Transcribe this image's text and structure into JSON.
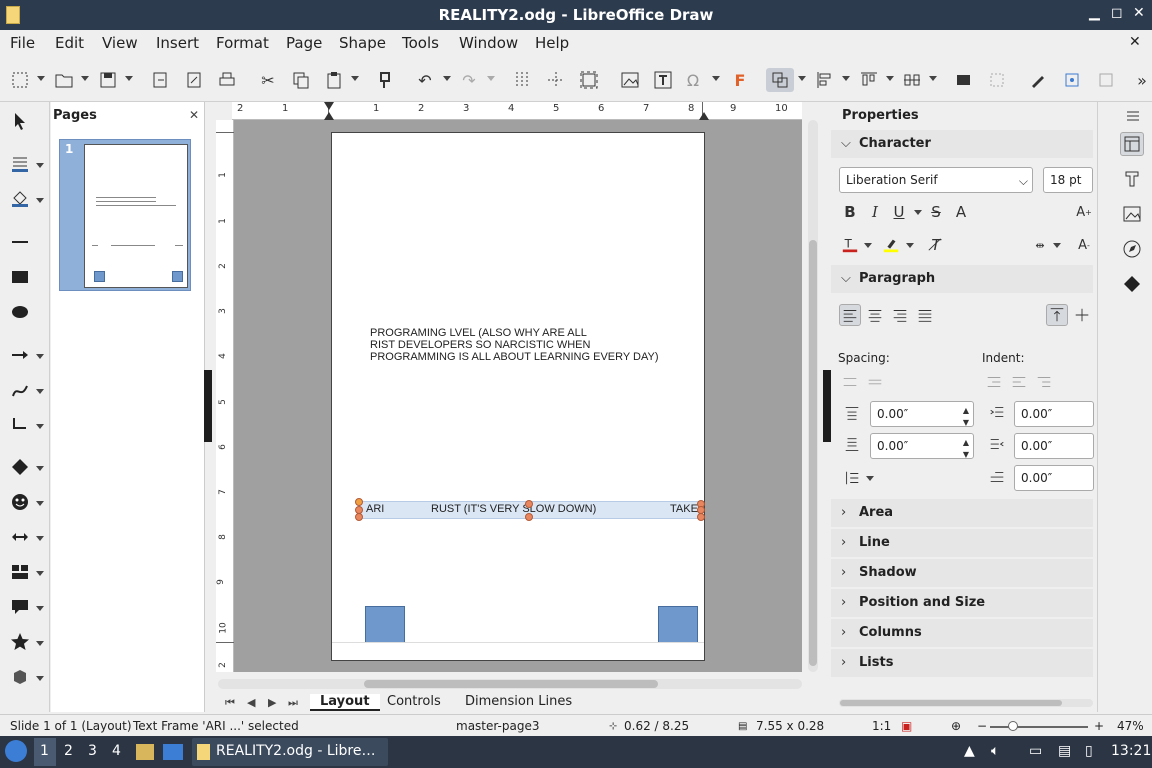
{
  "window": {
    "title": "REALITY2.odg - LibreOffice Draw"
  },
  "menu": [
    "File",
    "Edit",
    "View",
    "Insert",
    "Format",
    "Page",
    "Shape",
    "Tools",
    "Window",
    "Help"
  ],
  "pages_pane": {
    "title": "Pages",
    "thumbnail_number": "1"
  },
  "document": {
    "heading_lines": [
      "PROGRAMING LVEL (ALSO WHY ARE ALL",
      "RIST DEVELOPERS SO NARCISTIC WHEN",
      "PROGRAMMING IS ALL ABOUT LEARNING EVERY DAY)"
    ],
    "frame_left": "ARI",
    "frame_center": "RUST (IT'S VERY SLOW DOWN)",
    "frame_right": "TAKE"
  },
  "ruler": {
    "horizontal": [
      "2",
      "1",
      "1",
      "2",
      "3",
      "4",
      "5",
      "6",
      "7",
      "8",
      "9",
      "10"
    ],
    "vertical": [
      "1",
      "1",
      "2",
      "3",
      "4",
      "5",
      "6",
      "7",
      "8",
      "9",
      "10",
      "11",
      "2"
    ]
  },
  "tabs": [
    "Layout",
    "Controls",
    "Dimension Lines"
  ],
  "properties": {
    "title": "Properties",
    "character": {
      "header": "Character",
      "font_name": "Liberation Serif",
      "font_size": "18 pt"
    },
    "paragraph": {
      "header": "Paragraph",
      "spacing_label": "Spacing:",
      "indent_label": "Indent:",
      "spacing_above": "0.00″",
      "spacing_below": "0.00″",
      "indent_before": "0.00″",
      "indent_after": "0.00″",
      "indent_first": "0.00″"
    },
    "collapsed_sections": [
      "Area",
      "Line",
      "Shadow",
      "Position and Size",
      "Columns",
      "Lists"
    ]
  },
  "status": {
    "slide": "Slide 1 of 1 (Layout)",
    "selection": "Text Frame 'ARI     ...' selected",
    "master": "master-page3",
    "position": "0.62 / 8.25",
    "size": "7.55 x 0.28",
    "scale": "1:1",
    "zoom": "47%"
  },
  "taskbar": {
    "workspaces": [
      "1",
      "2",
      "3",
      "4"
    ],
    "active_task": "REALITY2.odg - Libre…",
    "clock": "13:21"
  },
  "colors": {
    "titlebar": "#2d3b4e",
    "taskbar": "#2b3544",
    "shape_fill": "#6f99cc",
    "handle": "#e8865f"
  }
}
